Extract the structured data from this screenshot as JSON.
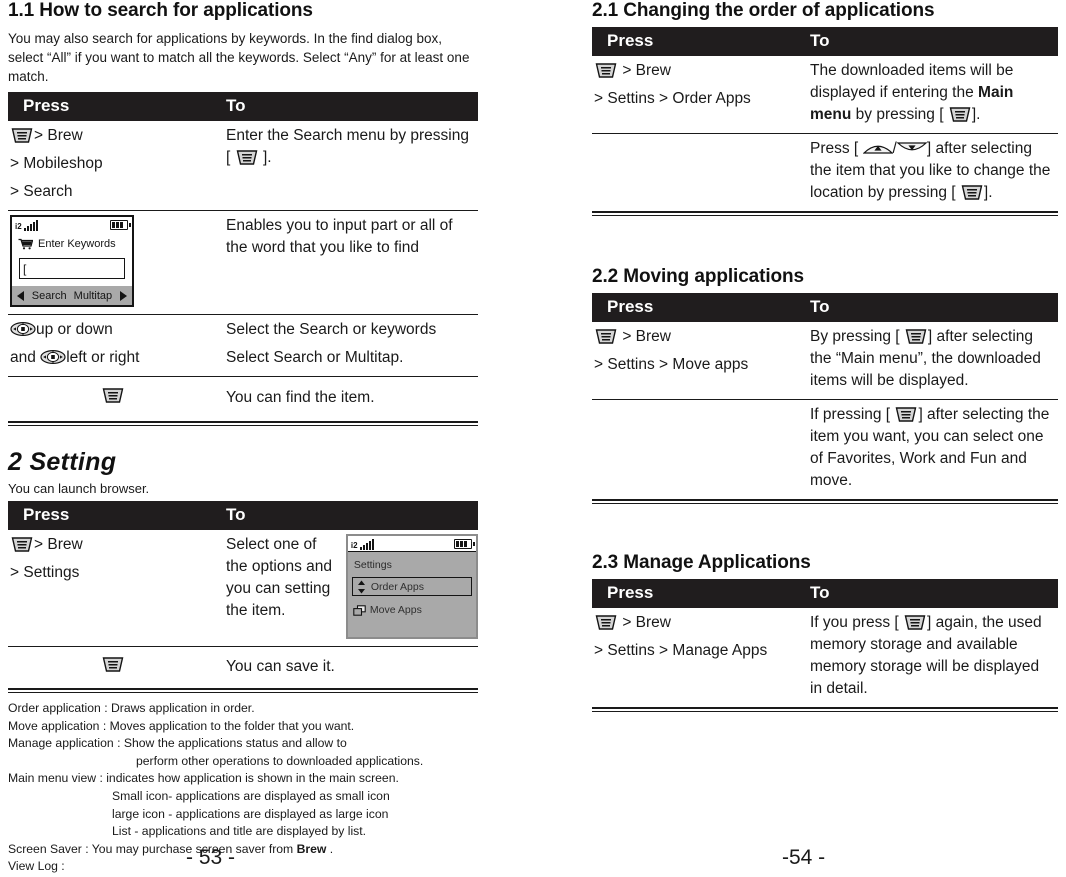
{
  "left": {
    "section_title": "1.1 How to search for applications",
    "intro": "You may also search for applications by keywords. In the find dialog box, select “All” if you want to match all the keywords. Select “Any” for at least one match.",
    "table_headers": {
      "press": "Press",
      "to": "To"
    },
    "rows": [
      {
        "press_lines": [
          "> Brew",
          ">  Mobileshop",
          "> Search"
        ],
        "to_pre": "Enter the Search menu by pressing [",
        "to_post": "].",
        "has_menu_icon_in_to": true
      },
      {
        "to_text": "Enables you to input part or all of the word that you like to find"
      },
      {
        "press_line1": "up or down",
        "press_and": "and",
        "press_line2": "left or right",
        "to_line1": "Select  the Search or keywords",
        "to_line2": "Select Search or Multitap."
      },
      {
        "to_text": "You can find the item."
      }
    ],
    "phone_search": {
      "signal_label": "i2",
      "keyword_label": "Enter Keywords",
      "input_value": "[",
      "soft_left": "Search",
      "soft_right": "Multitap"
    },
    "chapter": {
      "title": "2  Setting",
      "subtitle": "You can launch browser."
    },
    "settings_table": {
      "headers": {
        "press": "Press",
        "to": "To"
      },
      "row1": {
        "press_lines": [
          "> Brew",
          ">  Settings"
        ],
        "to_text": "Select one of the options and you can setting the item."
      },
      "row2": {
        "to_text": "You can save it."
      }
    },
    "phone_settings": {
      "title": "Settings",
      "selected_item": "Order Apps",
      "item2": "Move  Apps"
    },
    "notes": [
      {
        "text": "Order application : Draws application in order.",
        "indent": 0
      },
      {
        "text": "Move application : Moves application to the folder that you want.",
        "indent": 0
      },
      {
        "text": "Manage application : Show the applications status and allow to",
        "indent": 0
      },
      {
        "text": "perform other operations to downloaded applications.",
        "indent": 1
      },
      {
        "text": "Main menu view : indicates how application is shown in the main screen.",
        "indent": 0
      },
      {
        "text": "Small icon- applications are displayed as small icon",
        "indent": 2
      },
      {
        "text": "large icon - applications are displayed as large icon",
        "indent": 2
      },
      {
        "text": "List - applications and title are displayed by list.",
        "indent": 2
      },
      {
        "text": "Screen Saver : You may purchase screen saver from Brew .",
        "indent": 0,
        "bold_word": "Brew"
      },
      {
        "text": "View Log :",
        "indent": 0
      }
    ],
    "page_number": "- 53 -"
  },
  "right": {
    "sections": [
      {
        "title": "2.1  Changing the order of applications",
        "headers": {
          "press": "Press",
          "to": "To"
        },
        "row1": {
          "press_lines": [
            "> Brew",
            "> Settins > Order Apps"
          ],
          "to_part1": "The downloaded items will be displayed if entering the ",
          "to_bold": "Main menu",
          "to_part2": " by pressing [",
          "to_part3": "]."
        },
        "row2": {
          "to_part1": "Press [",
          "to_slash": "/",
          "to_part2": "] after selecting the item that you like to change the location by pressing [",
          "to_part3": "]."
        }
      },
      {
        "title": "2.2   Moving applications",
        "headers": {
          "press": "Press",
          "to": "To"
        },
        "row1": {
          "press_lines": [
            "> Brew",
            "> Settins > Move apps"
          ],
          "to_part1": "By pressing [",
          "to_part2": "] after selecting the “Main menu”, the downloaded items will be displayed."
        },
        "row2": {
          "to_part1": "If pressing [",
          "to_part2": "] after selecting the item you want, you can select one of Favorites, Work and Fun  and move."
        }
      },
      {
        "title": "2.3  Manage  Applications",
        "headers": {
          "press": "Press",
          "to": "To"
        },
        "row1": {
          "press_lines": [
            "> Brew",
            "> Settins > Manage Apps"
          ],
          "to_part1": "If you press [",
          "to_part2": "] again, the used memory storage and available memory storage will be displayed in detail."
        }
      }
    ],
    "page_number": "-54 -"
  },
  "icons": {
    "menu_key": "menu-key-icon",
    "nav_key": "navigation-key-icon",
    "vol_up": "volume-up-key-icon",
    "vol_down": "volume-down-key-icon",
    "cart": "shopping-cart-icon",
    "battery": "battery-icon",
    "signal": "signal-bars-icon"
  },
  "colors": {
    "header_bar": "#201d1e",
    "text": "#1a1a1a",
    "phone_gray": "#a9a9a9"
  }
}
